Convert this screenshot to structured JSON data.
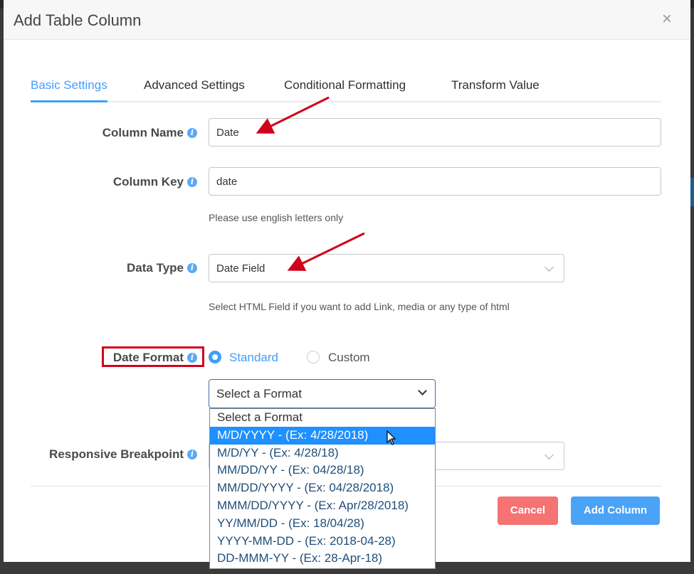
{
  "modal": {
    "title": "Add Table Column",
    "close_label": "×"
  },
  "tabs": [
    {
      "label": "Basic Settings",
      "active": true
    },
    {
      "label": "Advanced Settings",
      "active": false
    },
    {
      "label": "Conditional Formatting",
      "active": false
    },
    {
      "label": "Transform Value",
      "active": false
    }
  ],
  "fields": {
    "column_name": {
      "label": "Column Name",
      "value": "Date"
    },
    "column_key": {
      "label": "Column Key",
      "value": "date",
      "help": "Please use english letters only"
    },
    "data_type": {
      "label": "Data Type",
      "value": "Date Field",
      "help": "Select HTML Field if you want to add Link, media or any type of html"
    },
    "date_format": {
      "label": "Date Format",
      "radio_standard": "Standard",
      "radio_custom": "Custom",
      "selected_radio": "Standard",
      "select_value": "Select a Format"
    },
    "responsive_breakpoint": {
      "label": "Responsive Breakpoint"
    }
  },
  "format_options": [
    "Select a Format",
    "M/D/YYYY - (Ex: 4/28/2018)",
    "M/D/YY - (Ex: 4/28/18)",
    "MM/DD/YY - (Ex: 04/28/18)",
    "MM/DD/YYYY - (Ex: 04/28/2018)",
    "MMM/DD/YYYY - (Ex: Apr/28/2018)",
    "YY/MM/DD - (Ex: 18/04/28)",
    "YYYY-MM-DD - (Ex: 2018-04-28)",
    "DD-MMM-YY - (Ex: 28-Apr-18)"
  ],
  "highlighted_option": "M/D/YYYY - (Ex: 4/28/2018)",
  "buttons": {
    "cancel": "Cancel",
    "add": "Add Column"
  },
  "colors": {
    "accent": "#409eff",
    "cancel": "#f57373",
    "annotation": "#d0021b"
  },
  "icons": {
    "info": "info-icon",
    "close": "close-icon",
    "chevron": "chevron-down-icon",
    "cursor": "mouse-pointer-icon",
    "annotation": "red-arrow-annotation"
  }
}
